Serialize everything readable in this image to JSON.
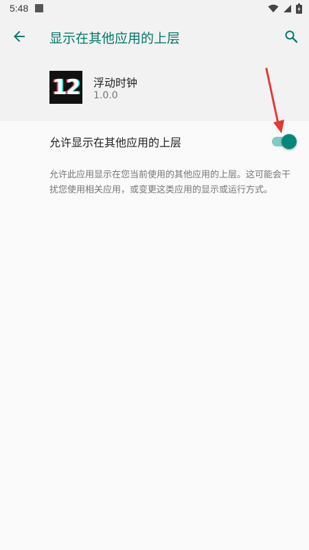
{
  "status_bar": {
    "time": "5:48"
  },
  "app_bar": {
    "title": "显示在其他应用的上层",
    "back_icon": "arrow-back-icon",
    "search_icon": "search-icon"
  },
  "app_info": {
    "icon_text": "12",
    "name": "浮动时钟",
    "version": "1.0.0"
  },
  "permission": {
    "label": "允许显示在其他应用的上层",
    "enabled": true,
    "description": "允许此应用显示在您当前使用的其他应用的上层。这可能会干扰您使用相关应用，或变更这类应用的显示或运行方式。"
  },
  "colors": {
    "accent": "#00796b",
    "switch_thumb": "#00897b",
    "switch_track": "#80cbc4",
    "annotation": "#e53935"
  }
}
